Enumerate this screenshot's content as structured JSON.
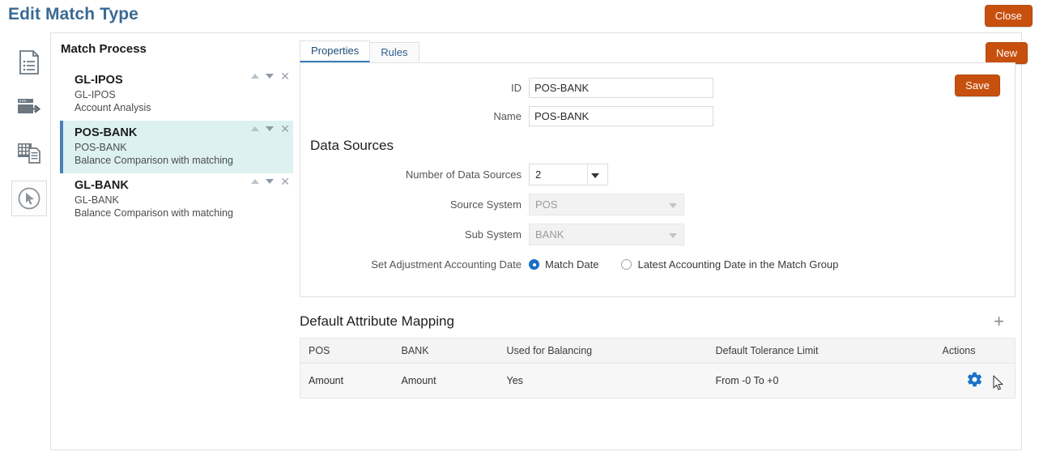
{
  "page": {
    "title": "Edit Match Type",
    "close_label": "Close",
    "new_label": "New",
    "save_label": "Save"
  },
  "rail": {
    "items": [
      {
        "name": "document-list-icon",
        "label": "Document List"
      },
      {
        "name": "export-window-icon",
        "label": "Export"
      },
      {
        "name": "grid-document-icon",
        "label": "Data Grid"
      },
      {
        "name": "cursor-circle-icon",
        "label": "Match Type"
      }
    ]
  },
  "match_process": {
    "heading": "Match Process",
    "items": [
      {
        "name": "GL-IPOS",
        "id": "GL-IPOS",
        "description": "Account Analysis",
        "selected": false
      },
      {
        "name": "POS-BANK",
        "id": "POS-BANK",
        "description": "Balance Comparison with matching",
        "selected": true
      },
      {
        "name": "GL-BANK",
        "id": "GL-BANK",
        "description": "Balance Comparison with matching",
        "selected": false
      }
    ]
  },
  "tabs": [
    {
      "label": "Properties",
      "active": true
    },
    {
      "label": "Rules",
      "active": false
    }
  ],
  "properties": {
    "id_label": "ID",
    "id_value": "POS-BANK",
    "name_label": "Name",
    "name_value": "POS-BANK",
    "data_sources": {
      "section_title": "Data Sources",
      "number_label": "Number of Data Sources",
      "number_value": "2",
      "source_system_label": "Source System",
      "source_system_value": "POS",
      "sub_system_label": "Sub System",
      "sub_system_value": "BANK",
      "adjustment_label": "Set Adjustment Accounting Date",
      "radio_options": [
        {
          "label": "Match Date",
          "selected": true
        },
        {
          "label": "Latest Accounting Date in the Match Group",
          "selected": false
        }
      ]
    }
  },
  "attribute_mapping": {
    "title": "Default Attribute Mapping",
    "add_icon": "+",
    "columns": [
      "POS",
      "BANK",
      "Used for Balancing",
      "Default Tolerance Limit",
      "Actions"
    ],
    "rows": [
      {
        "pos": "Amount",
        "bank": "Amount",
        "used_for_balancing": "Yes",
        "default_tolerance_limit": "From -0 To +0",
        "action_icon": "gear-icon"
      }
    ]
  },
  "colors": {
    "accent_orange": "#c8500f",
    "title_blue": "#3a6a93",
    "selected_row": "#ddf1f1",
    "selected_border": "#4a7fbd",
    "gear_blue": "#1a72c8",
    "radio_blue": "#1a6fc4"
  }
}
